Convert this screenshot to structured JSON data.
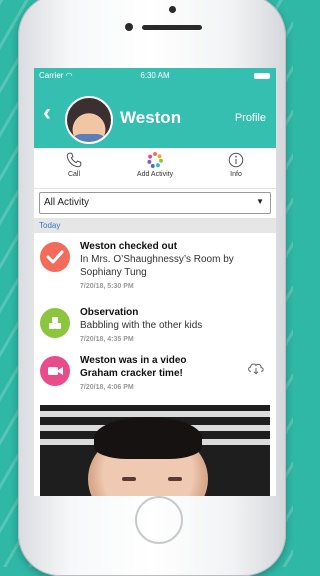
{
  "status_bar": {
    "carrier": "Carrier ◠",
    "time": "6:30 AM"
  },
  "header": {
    "back": "‹",
    "child_name": "Weston",
    "profile_label": "Profile"
  },
  "actions": [
    {
      "label": "Call",
      "icon": "phone-icon"
    },
    {
      "label": "Add Activity",
      "icon": "activity-pinwheel-icon"
    },
    {
      "label": "Info",
      "icon": "info-icon"
    }
  ],
  "filter": {
    "selected": "All Activity",
    "caret": "▼"
  },
  "section": {
    "label": "Today"
  },
  "feed": [
    {
      "icon": "checkmark-icon",
      "color": "#f26b5b",
      "title": "Weston checked out",
      "lines": [
        "In Mrs. O’Shaughnessy’s Room by",
        "Sophiany Tung"
      ],
      "timestamp": "7/20/18, 5:30 PM"
    },
    {
      "icon": "blocks-icon",
      "color": "#8cc63f",
      "title": "Observation",
      "lines": [
        "Babbling with the other kids"
      ],
      "timestamp": "7/20/18, 4:35 PM"
    },
    {
      "icon": "video-camera-icon",
      "color": "#e94c8b",
      "title": "Weston was in a video",
      "lines": [
        "Graham cracker time!"
      ],
      "timestamp": "7/20/18, 4:06 PM",
      "action_icon": "cloud-download-icon"
    }
  ],
  "colors": {
    "brand": "#35bfb0",
    "link": "#3a75c4"
  }
}
